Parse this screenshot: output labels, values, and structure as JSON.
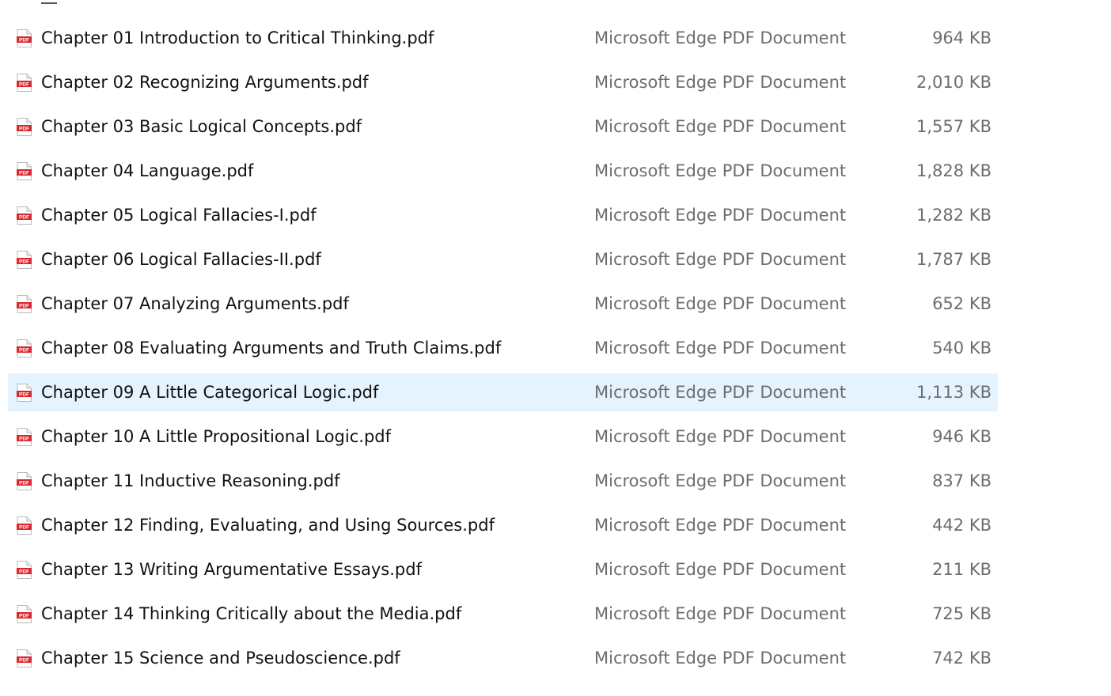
{
  "files": [
    {
      "name": "Chapter 01 Introduction to Critical Thinking.pdf",
      "type": "Microsoft Edge PDF Document",
      "size": "964 KB",
      "selected": false
    },
    {
      "name": "Chapter 02 Recognizing Arguments.pdf",
      "type": "Microsoft Edge PDF Document",
      "size": "2,010 KB",
      "selected": false
    },
    {
      "name": "Chapter 03 Basic Logical Concepts.pdf",
      "type": "Microsoft Edge PDF Document",
      "size": "1,557 KB",
      "selected": false
    },
    {
      "name": "Chapter 04 Language.pdf",
      "type": "Microsoft Edge PDF Document",
      "size": "1,828 KB",
      "selected": false
    },
    {
      "name": "Chapter 05 Logical Fallacies-I.pdf",
      "type": "Microsoft Edge PDF Document",
      "size": "1,282 KB",
      "selected": false
    },
    {
      "name": "Chapter 06 Logical Fallacies-II.pdf",
      "type": "Microsoft Edge PDF Document",
      "size": "1,787 KB",
      "selected": false
    },
    {
      "name": "Chapter 07 Analyzing Arguments.pdf",
      "type": "Microsoft Edge PDF Document",
      "size": "652 KB",
      "selected": false
    },
    {
      "name": "Chapter 08 Evaluating Arguments and Truth Claims.pdf",
      "type": "Microsoft Edge PDF Document",
      "size": "540 KB",
      "selected": false
    },
    {
      "name": "Chapter 09 A Little Categorical Logic.pdf",
      "type": "Microsoft Edge PDF Document",
      "size": "1,113 KB",
      "selected": true
    },
    {
      "name": "Chapter 10 A Little Propositional Logic.pdf",
      "type": "Microsoft Edge PDF Document",
      "size": "946 KB",
      "selected": false
    },
    {
      "name": "Chapter 11 Inductive Reasoning.pdf",
      "type": "Microsoft Edge PDF Document",
      "size": "837 KB",
      "selected": false
    },
    {
      "name": "Chapter 12 Finding, Evaluating, and Using Sources.pdf",
      "type": "Microsoft Edge PDF Document",
      "size": "442 KB",
      "selected": false
    },
    {
      "name": "Chapter 13 Writing Argumentative Essays.pdf",
      "type": "Microsoft Edge PDF Document",
      "size": "211 KB",
      "selected": false
    },
    {
      "name": "Chapter 14 Thinking Critically about the Media.pdf",
      "type": "Microsoft Edge PDF Document",
      "size": "725 KB",
      "selected": false
    },
    {
      "name": "Chapter 15 Science and Pseudoscience.pdf",
      "type": "Microsoft Edge PDF Document",
      "size": "742 KB",
      "selected": false
    }
  ],
  "icons": {
    "file_icon": "pdf-file-icon",
    "icon_badge_text": "PDF"
  },
  "colors": {
    "selection": "#e5f3ff",
    "name_text": "#111111",
    "detail_text": "#6d6d6d",
    "pdf_red": "#d8262b"
  }
}
